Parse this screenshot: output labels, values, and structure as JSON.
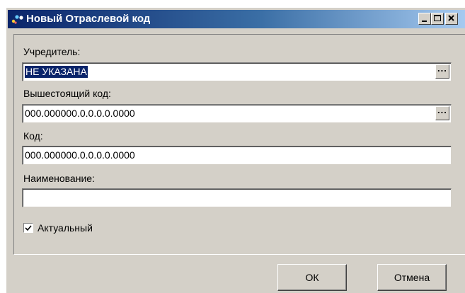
{
  "window": {
    "title": "Новый Отраслевой код",
    "minimize_icon": "minimize-icon",
    "maximize_icon": "maximize-icon",
    "close_icon": "close-icon"
  },
  "form": {
    "founder": {
      "label": "Учредитель:",
      "value": "НЕ УКАЗАНА",
      "button": "..."
    },
    "parent_code": {
      "label": "Вышестоящий код:",
      "value": "000.000000.0.0.0.0.0000",
      "button": "..."
    },
    "code": {
      "label": "Код:",
      "value": "000.000000.0.0.0.0.0000"
    },
    "name": {
      "label": "Наименование:",
      "value": ""
    },
    "active": {
      "label": "Актуальный",
      "checked": true
    }
  },
  "buttons": {
    "ok": "ОК",
    "cancel": "Отмена"
  }
}
